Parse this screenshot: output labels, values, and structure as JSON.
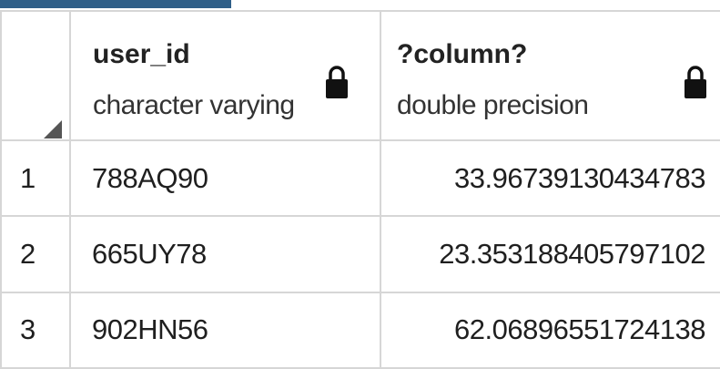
{
  "columns": [
    {
      "name": "user_id",
      "type": "character varying"
    },
    {
      "name": "?column?",
      "type": "double precision"
    }
  ],
  "rows": [
    {
      "num": "1",
      "user_id": "788AQ90",
      "value": "33.96739130434783"
    },
    {
      "num": "2",
      "user_id": "665UY78",
      "value": "23.353188405797102"
    },
    {
      "num": "3",
      "user_id": "902HN56",
      "value": "62.06896551724138"
    }
  ],
  "icons": {
    "lock": "lock-icon",
    "sort_corner": "corner-triangle-icon"
  },
  "colors": {
    "tab": "#2f5f88",
    "grid_border": "#d6d6d6",
    "text": "#1f1f1f"
  }
}
